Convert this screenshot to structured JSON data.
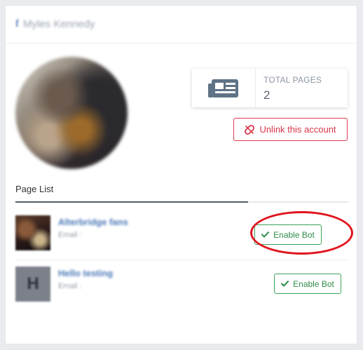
{
  "header": {
    "platform_icon": "facebook-f-icon",
    "account_name": "Myles Kennedy"
  },
  "profile": {
    "avatar": "profile-photo"
  },
  "stats": {
    "icon": "newspaper-icon",
    "label": "TOTAL PAGES",
    "value": "2"
  },
  "actions": {
    "unlink_icon": "unlink-icon",
    "unlink_label": "Unlink this account"
  },
  "tabs": {
    "active_label": "Page List"
  },
  "pages": [
    {
      "name": "Alterbridge fans",
      "email_label": "Email :",
      "thumb": "page-photo",
      "button_label": "Enable Bot",
      "button_icon": "check-icon"
    },
    {
      "name": "Hello testing",
      "email_label": "Email :",
      "thumb_letter": "H",
      "button_label": "Enable Bot",
      "button_icon": "check-icon"
    }
  ],
  "colors": {
    "danger": "#d83647",
    "success": "#2f8d4a",
    "tab_active": "#4d5f6f",
    "annotation": "#e0141e"
  }
}
